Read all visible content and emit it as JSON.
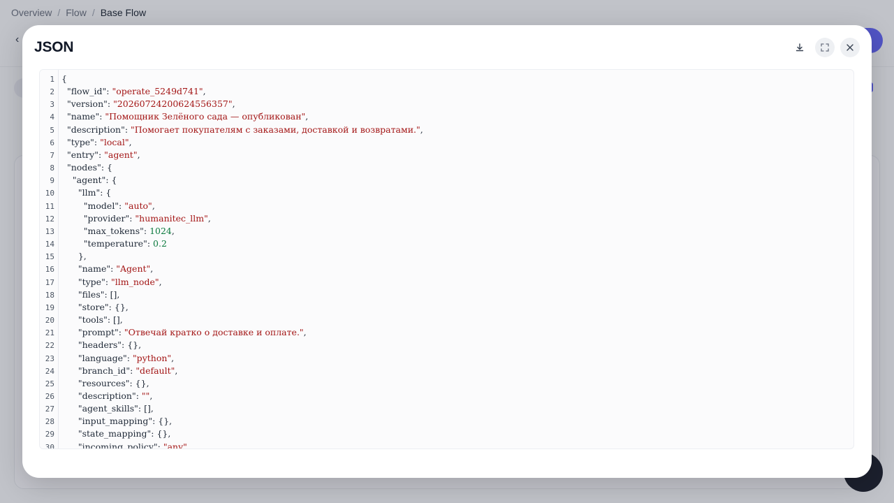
{
  "breadcrumb": [
    "Overview",
    "Flow",
    "Base Flow"
  ],
  "modal": {
    "title": "JSON",
    "actions": [
      "download-icon",
      "expand-icon",
      "close-icon"
    ]
  },
  "code_lines": [
    "{",
    "  \"flow_id\": \"operate_5249d741\",",
    "  \"version\": \"20260724200624556357\",",
    "  \"name\": \"Помощник Зелёного сада — опубликован\",",
    "  \"description\": \"Помогает покупателям с заказами, доставкой и возвратами.\",",
    "  \"type\": \"local\",",
    "  \"entry\": \"agent\",",
    "  \"nodes\": {",
    "    \"agent\": {",
    "      \"llm\": {",
    "        \"model\": \"auto\",",
    "        \"provider\": \"humanitec_llm\",",
    "        \"max_tokens\": 1024,",
    "        \"temperature\": 0.2",
    "      },",
    "      \"name\": \"Agent\",",
    "      \"type\": \"llm_node\",",
    "      \"files\": [],",
    "      \"store\": {},",
    "      \"tools\": [],",
    "      \"prompt\": \"Отвечай кратко о доставке и оплате.\",",
    "      \"headers\": {},",
    "      \"language\": \"python\",",
    "      \"branch_id\": \"default\",",
    "      \"resources\": {},",
    "      \"description\": \"\",",
    "      \"agent_skills\": [],",
    "      \"input_mapping\": {},",
    "      \"state_mapping\": {},",
    "      \"incoming_policy\": \"any\","
  ]
}
